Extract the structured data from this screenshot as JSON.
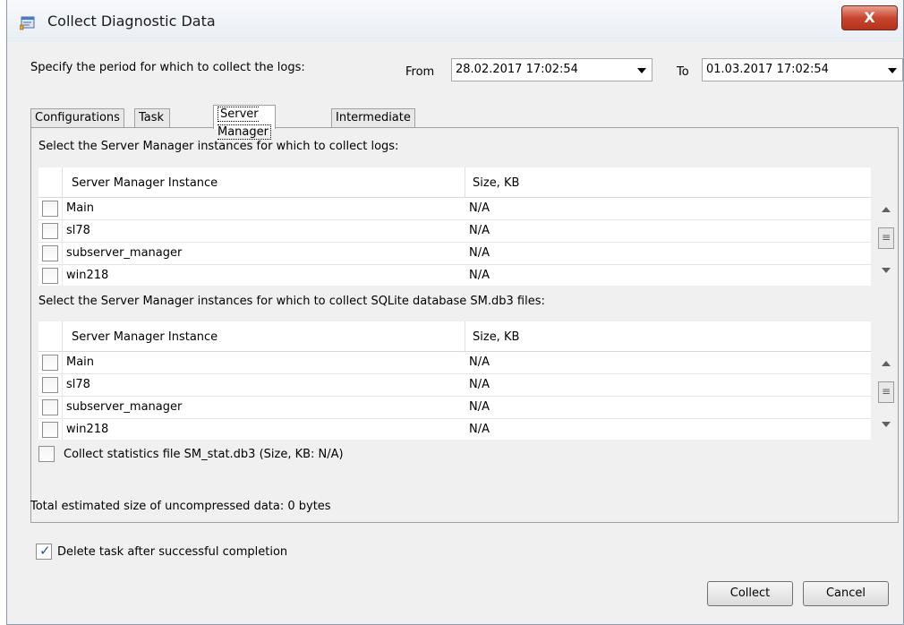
{
  "window": {
    "title": "Collect Diagnostic Data",
    "close_label": "X",
    "icon": "app-diagnostic-icon"
  },
  "period": {
    "label": "Specify the period for which to collect the logs:",
    "from_label": "From",
    "from_value": "28.02.2017 17:02:54",
    "to_label": "To",
    "to_value": "01.03.2017 17:02:54"
  },
  "tabs": [
    {
      "label": "Configurations",
      "active": false
    },
    {
      "label": "Task Logs",
      "active": false
    },
    {
      "label": "Server Manager",
      "active": true
    },
    {
      "label": "Intermediate Files",
      "active": false
    }
  ],
  "logs_section": {
    "label": "Select the Server Manager instances for which to collect logs:",
    "columns": [
      "Server Manager Instance",
      "Size, KB"
    ],
    "rows": [
      {
        "name": "Main",
        "size": "N/A",
        "checked": false
      },
      {
        "name": "sl78",
        "size": "N/A",
        "checked": false
      },
      {
        "name": "subserver_manager",
        "size": "N/A",
        "checked": false
      },
      {
        "name": "win218",
        "size": "N/A",
        "checked": false
      }
    ]
  },
  "db_section": {
    "label": "Select the Server Manager instances for which to collect SQLite database SM.db3 files:",
    "columns": [
      "Server Manager Instance",
      "Size, KB"
    ],
    "rows": [
      {
        "name": "Main",
        "size": "N/A",
        "checked": false
      },
      {
        "name": "sl78",
        "size": "N/A",
        "checked": false
      },
      {
        "name": "subserver_manager",
        "size": "N/A",
        "checked": false
      },
      {
        "name": "win218",
        "size": "N/A",
        "checked": false
      }
    ]
  },
  "stats": {
    "label": "Collect statistics file SM_stat.db3 (Size, KB: N/A)",
    "checked": false
  },
  "total": {
    "label": "Total estimated size of uncompressed data:  0 bytes"
  },
  "delete_task": {
    "label": "Delete task after successful completion",
    "checked": true
  },
  "buttons": {
    "collect": "Collect",
    "cancel": "Cancel"
  },
  "colors": {
    "window_bg": "#f0f0f0",
    "close_button": "#c8452f",
    "check_mark": "#1e4fa8"
  }
}
